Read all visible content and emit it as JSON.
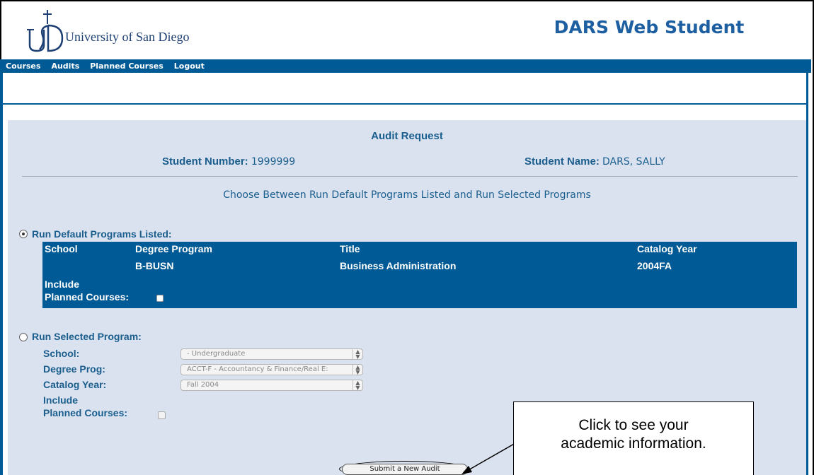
{
  "header": {
    "university_name": "University of San Diego",
    "logo_letters": "USD",
    "app_title": "DARS Web Student"
  },
  "nav": {
    "items": [
      "Courses",
      "Audits",
      "Planned Courses",
      "Logout"
    ]
  },
  "audit": {
    "title": "Audit Request",
    "student_number_label": "Student Number:",
    "student_number": "1999999",
    "student_name_label": "Student Name:",
    "student_name": "DARS, SALLY",
    "instructions": "Choose Between Run Default Programs Listed and Run Selected Programs"
  },
  "default_programs": {
    "label": "Run Default Programs Listed:",
    "selected": true,
    "headers": {
      "school": "School",
      "degree_program": "Degree Program",
      "title": "Title",
      "catalog_year": "Catalog Year"
    },
    "row": {
      "school": "",
      "degree_program": "B-BUSN",
      "title": "Business Administration",
      "catalog_year": "2004FA"
    },
    "include_label_1": "Include",
    "include_label_2": "Planned Courses:"
  },
  "selected_program": {
    "label": "Run Selected Program:",
    "selected": false,
    "school_label": "School:",
    "school_value": "- Undergraduate",
    "degree_label": "Degree Prog:",
    "degree_value": "ACCT-F - Accountancy & Finance/Real E:",
    "catalog_label": "Catalog Year:",
    "catalog_value": "Fall 2004",
    "include_label_1": "Include",
    "include_label_2": "Planned Courses:"
  },
  "submit_label": "Submit a New Audit",
  "callout": {
    "line1": "Click to see your",
    "line2": "academic information."
  },
  "colors": {
    "nav_blue": "#005a96",
    "panel_bg": "#dbe2ef",
    "text_blue": "#1a5e8e"
  }
}
